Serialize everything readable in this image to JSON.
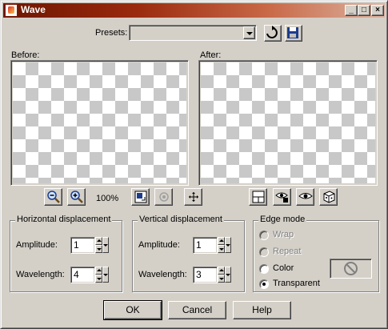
{
  "window": {
    "title": "Wave",
    "controls": {
      "minimize": "_",
      "maximize": "□",
      "close": "×"
    }
  },
  "presets": {
    "label": "Presets:",
    "value": ""
  },
  "preview": {
    "before_label": "Before:",
    "after_label": "After:",
    "zoom": "100%"
  },
  "horizontal": {
    "title": "Horizontal displacement",
    "amplitude_label": "Amplitude:",
    "amplitude_value": "1",
    "wavelength_label": "Wavelength:",
    "wavelength_value": "4"
  },
  "vertical": {
    "title": "Vertical displacement",
    "amplitude_label": "Amplitude:",
    "amplitude_value": "1",
    "wavelength_label": "Wavelength:",
    "wavelength_value": "3"
  },
  "edge_mode": {
    "title": "Edge mode",
    "options": [
      "Wrap",
      "Repeat",
      "Color",
      "Transparent"
    ],
    "selected": "Transparent"
  },
  "buttons": {
    "ok": "OK",
    "cancel": "Cancel",
    "help": "Help"
  },
  "colors": {
    "title_start": "#6d1600",
    "title_end": "#dcb2a0",
    "face": "#d4d0c8"
  }
}
